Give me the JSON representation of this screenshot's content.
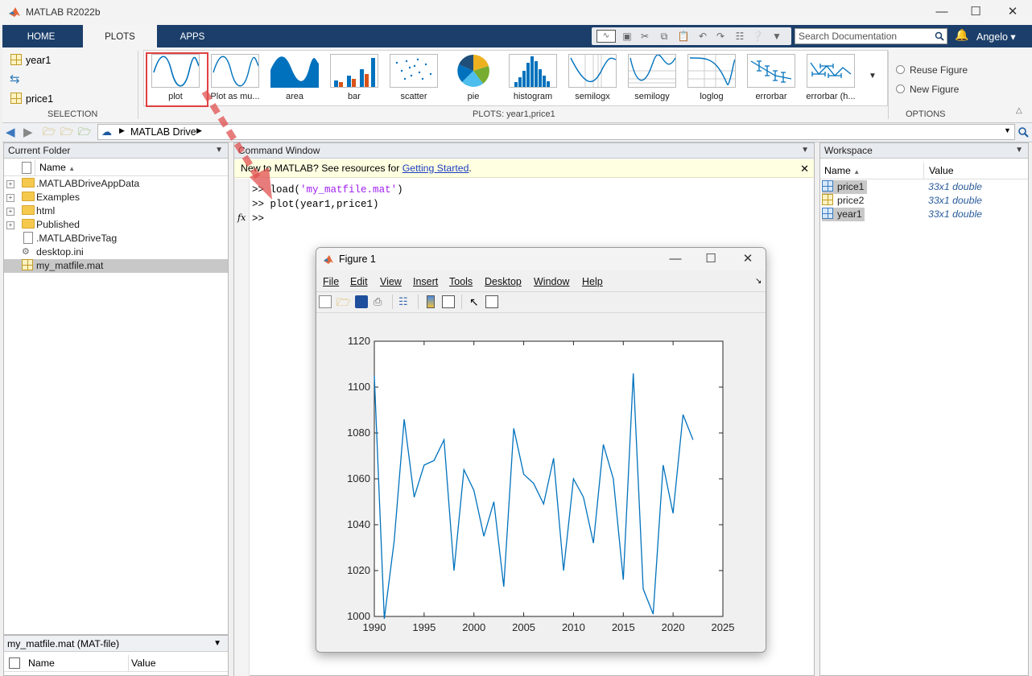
{
  "window": {
    "title": "MATLAB R2022b"
  },
  "tabs": [
    "HOME",
    "PLOTS",
    "APPS"
  ],
  "search_placeholder": "Search Documentation",
  "user": "Angelo",
  "selection": {
    "items": [
      "year1",
      "price1"
    ],
    "label": "SELECTION"
  },
  "gallery": {
    "items": [
      "plot",
      "Plot as mu...",
      "area",
      "bar",
      "scatter",
      "pie",
      "histogram",
      "semilogx",
      "semilogy",
      "loglog",
      "errorbar",
      "errorbar (h..."
    ],
    "section_label": "PLOTS: year1,price1"
  },
  "options": {
    "reuse": "Reuse Figure",
    "new": "New Figure",
    "label": "OPTIONS"
  },
  "address": {
    "path": "MATLAB Drive"
  },
  "current_folder": {
    "title": "Current Folder",
    "col_name": "Name",
    "files": [
      {
        "name": ".MATLABDriveAppData",
        "type": "folder"
      },
      {
        "name": "Examples",
        "type": "folder"
      },
      {
        "name": "html",
        "type": "folder"
      },
      {
        "name": "Published",
        "type": "folder"
      },
      {
        "name": ".MATLABDriveTag",
        "type": "file"
      },
      {
        "name": "desktop.ini",
        "type": "file"
      },
      {
        "name": "my_matfile.mat",
        "type": "mat"
      }
    ],
    "details_title": "my_matfile.mat  (MAT-file)",
    "details_col_name": "Name",
    "details_col_value": "Value"
  },
  "command_window": {
    "title": "Command Window",
    "banner_text": "New to MATLAB? See resources for ",
    "banner_link": "Getting Started",
    "banner_end": ".",
    "prompt": ">>",
    "line1_cmd": "load(",
    "line1_str": "'my_matfile.mat'",
    "line1_end": ")",
    "line2": "plot(year1,price1)",
    "fx": "fx"
  },
  "workspace": {
    "title": "Workspace",
    "col_name": "Name",
    "col_value": "Value",
    "vars": [
      {
        "name": "price1",
        "value": "33x1 double"
      },
      {
        "name": "price2",
        "value": "33x1 double"
      },
      {
        "name": "year1",
        "value": "33x1 double"
      }
    ]
  },
  "figure": {
    "title": "Figure 1",
    "menus": [
      "File",
      "Edit",
      "View",
      "Insert",
      "Tools",
      "Desktop",
      "Window",
      "Help"
    ]
  },
  "chart_data": {
    "type": "line",
    "title": "",
    "xlabel": "",
    "ylabel": "",
    "xlim": [
      1990,
      2025
    ],
    "ylim": [
      1000,
      1120
    ],
    "xticks": [
      1990,
      1995,
      2000,
      2005,
      2010,
      2015,
      2020,
      2025
    ],
    "yticks": [
      1000,
      1020,
      1040,
      1060,
      1080,
      1100,
      1120
    ],
    "color": "#0072bd",
    "x": [
      1990,
      1991,
      1992,
      1993,
      1994,
      1995,
      1996,
      1997,
      1998,
      1999,
      2000,
      2001,
      2002,
      2003,
      2004,
      2005,
      2006,
      2007,
      2008,
      2009,
      2010,
      2011,
      2012,
      2013,
      2014,
      2015,
      2016,
      2017,
      2018,
      2019,
      2020,
      2021,
      2022
    ],
    "y": [
      1105,
      999,
      1033,
      1086,
      1052,
      1066,
      1068,
      1077,
      1020,
      1064,
      1055,
      1035,
      1050,
      1013,
      1082,
      1062,
      1058,
      1049,
      1069,
      1020,
      1060,
      1052,
      1032,
      1075,
      1060,
      1016,
      1106,
      1012,
      1001,
      1066,
      1045,
      1088,
      1077
    ]
  },
  "colors": {
    "ribbon_tab": "#1b3f6a",
    "line": "#0072bd",
    "highlight": "#e04040"
  }
}
